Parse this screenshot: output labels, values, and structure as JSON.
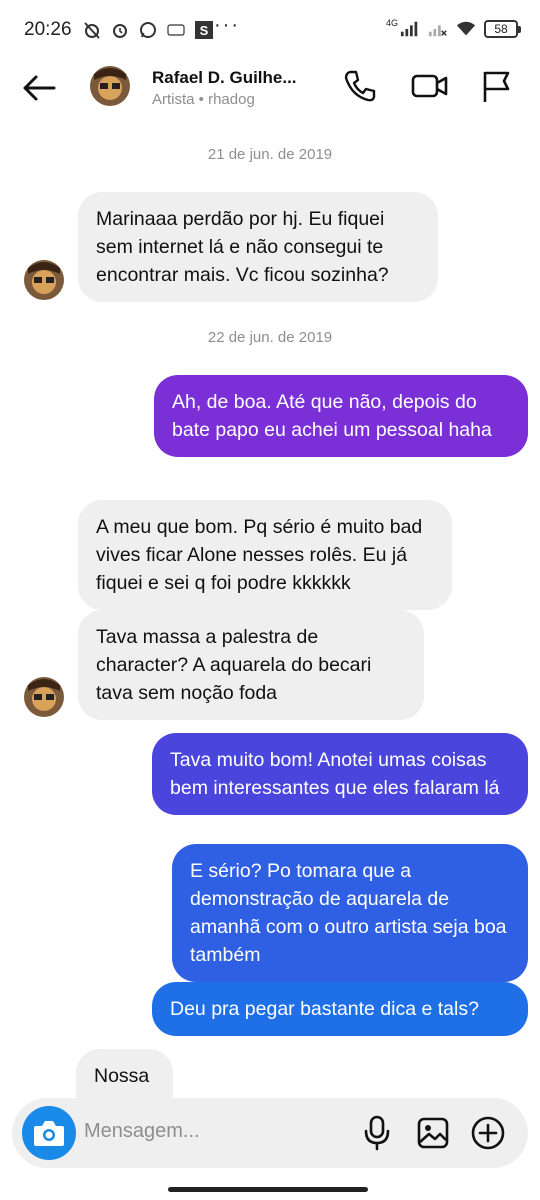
{
  "status_bar": {
    "time": "20:26",
    "dots": "···",
    "network": "4G",
    "battery": "58"
  },
  "header": {
    "name": "Rafael D. Guilhe...",
    "subtitle": "Artista • rhadog"
  },
  "conversation": {
    "dates": [
      "21 de jun. de 2019",
      "22 de jun. de 2019"
    ],
    "messages": [
      {
        "from": "them",
        "text": "Marinaaa perdão por hj. Eu fiquei sem internet lá e não consegui te encontrar mais. Vc ficou sozinha?"
      },
      {
        "from": "me",
        "text": "Ah, de boa. Até que não, depois do bate papo eu achei um pessoal haha"
      },
      {
        "from": "them",
        "text": "A meu que bom. Pq sério é muito bad vives ficar Alone nesses rolês. Eu já fiquei e sei q foi podre kkkkkk"
      },
      {
        "from": "them",
        "text": "Tava massa a palestra de character? A aquarela do becari tava sem noção  foda"
      },
      {
        "from": "me",
        "text": "Tava muito bom! Anotei umas coisas bem interessantes que eles falaram lá"
      },
      {
        "from": "me",
        "text": "E sério? Po tomara que a demonstração de aquarela de amanhã com o outro artista seja boa também"
      },
      {
        "from": "me",
        "text": "Deu pra pegar bastante dica e tals?"
      },
      {
        "from": "them",
        "text": "Nossa"
      }
    ]
  },
  "composer": {
    "placeholder": "Mensagem..."
  },
  "colors": {
    "incoming_bubble": "#efefef",
    "outgoing_purple": "#7b2fd6",
    "outgoing_indigo": "#4a45dc",
    "outgoing_blue": "#1f6fe6",
    "camera_button": "#1a8ae8",
    "secondary_text": "#8e8e8e"
  },
  "icons": [
    "back-arrow-icon",
    "phone-icon",
    "video-icon",
    "flag-icon",
    "camera-icon",
    "microphone-icon",
    "gallery-icon",
    "add-icon"
  ]
}
